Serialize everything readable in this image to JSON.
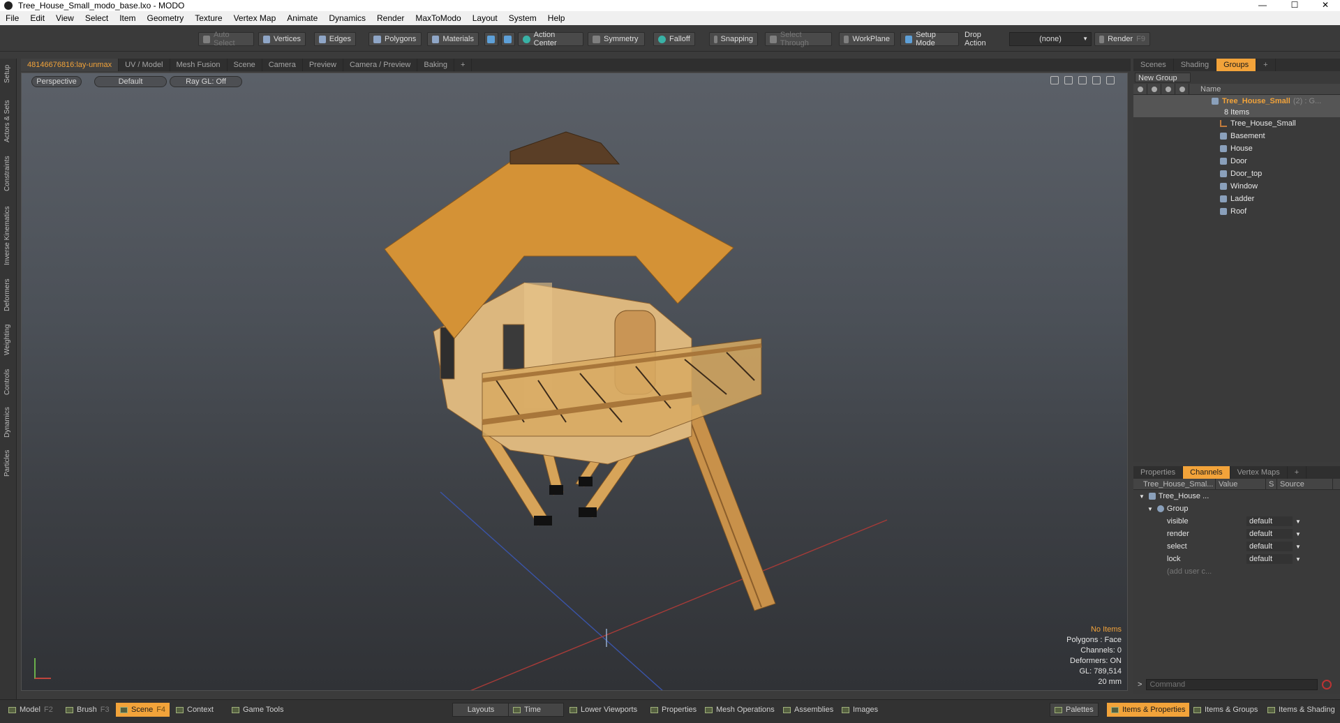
{
  "window": {
    "title": "Tree_House_Small_modo_base.lxo - MODO",
    "minimize": "—",
    "maximize": "☐",
    "close": "✕"
  },
  "menu": [
    "File",
    "Edit",
    "View",
    "Select",
    "Item",
    "Geometry",
    "Texture",
    "Vertex Map",
    "Animate",
    "Dynamics",
    "Render",
    "MaxToModo",
    "Layout",
    "System",
    "Help"
  ],
  "toolbar": {
    "auto_select": "Auto Select",
    "vertices": "Vertices",
    "edges": "Edges",
    "polygons": "Polygons",
    "materials": "Materials",
    "action_center": "Action Center",
    "symmetry": "Symmetry",
    "falloff": "Falloff",
    "snapping": "Snapping",
    "select_through": "Select Through",
    "workplane": "WorkPlane",
    "setup_mode": "Setup Mode",
    "drop_action": "Drop Action",
    "drop_value": "(none)",
    "render": "Render",
    "render_key": "F9"
  },
  "left_tabs": [
    "Setup",
    "Actors & Sets",
    "Constraints",
    "Inverse Kinematics",
    "Deformers",
    "Weighting",
    "Controls",
    "Dynamics",
    "Particles"
  ],
  "viewport_tabs": [
    "48146676816:lay-unmax",
    "UV / Model",
    "Mesh Fusion",
    "Scene",
    "Camera",
    "Preview",
    "Camera / Preview",
    "Baking",
    "+"
  ],
  "viewport": {
    "view": "Perspective",
    "shading": "Default",
    "raygl": "Ray GL: Off",
    "info": {
      "selection": "No Items",
      "polygons": "Polygons : Face",
      "channels": "Channels: 0",
      "deformers": "Deformers: ON",
      "gl": "GL: 789,514",
      "unit": "20 mm"
    }
  },
  "groups_panel": {
    "tabs": [
      "Scenes",
      "Shading",
      "Groups",
      "+"
    ],
    "new_group": "New Group",
    "name_header": "Name",
    "group_name": "Tree_House_Small",
    "group_suffix": "(2) : G...",
    "count": "8 Items",
    "items": [
      "Tree_House_Small",
      "Basement",
      "House",
      "Door",
      "Door_top",
      "Window",
      "Ladder",
      "Roof"
    ]
  },
  "channels_panel": {
    "tabs": [
      "Properties",
      "Channels",
      "Vertex Maps",
      "+"
    ],
    "headers": {
      "name": "Tree_House_Smal...",
      "value": "Value",
      "s": "S",
      "source": "Source"
    },
    "root": "Tree_House ...",
    "group": "Group",
    "rows": [
      {
        "name": "visible",
        "value": "default"
      },
      {
        "name": "render",
        "value": "default"
      },
      {
        "name": "select",
        "value": "default"
      },
      {
        "name": "lock",
        "value": "default"
      }
    ],
    "add_user": "(add user c..."
  },
  "command": {
    "prompt": ">",
    "placeholder": "Command"
  },
  "bottombar": {
    "model": "Model",
    "model_key": "F2",
    "brush": "Brush",
    "brush_key": "F3",
    "scene": "Scene",
    "scene_key": "F4",
    "context": "Context",
    "game_tools": "Game Tools",
    "layouts": "Layouts",
    "time": "Time",
    "lower_viewports": "Lower Viewports",
    "properties": "Properties",
    "mesh_operations": "Mesh Operations",
    "assemblies": "Assemblies",
    "images": "Images",
    "palettes": "Palettes",
    "items_properties": "Items & Properties",
    "items_groups": "Items & Groups",
    "items_shading": "Items & Shading"
  },
  "colors": {
    "accent": "#f2a33a",
    "viewport_top": "#5b6068",
    "viewport_bottom": "#303236"
  }
}
